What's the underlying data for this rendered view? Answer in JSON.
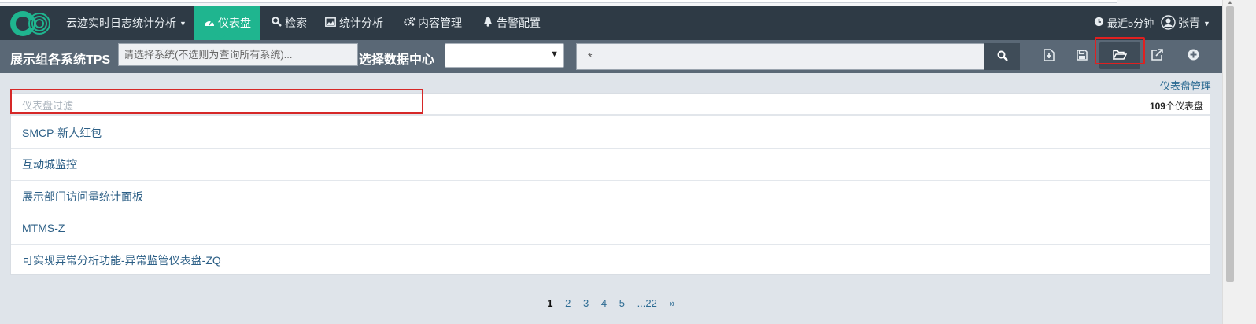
{
  "navbar": {
    "app_menu": "云迹实时日志统计分析",
    "items": [
      {
        "label": "仪表盘",
        "icon": "dashboard-icon",
        "active": true
      },
      {
        "label": "检索",
        "icon": "search-icon"
      },
      {
        "label": "统计分析",
        "icon": "image-chart-icon"
      },
      {
        "label": "内容管理",
        "icon": "gears-icon"
      },
      {
        "label": "告警配置",
        "icon": "bell-icon"
      }
    ],
    "time_range": "最近5分钟",
    "user": "张青"
  },
  "toolbar": {
    "title": "展示组各系统TPS",
    "system_placeholder": "请选择系统(不选则为查询所有系统)...",
    "datacenter_label": "选择数据中心",
    "datacenter_value": "",
    "query_value": "*",
    "icons": [
      "new-dashboard-icon",
      "save-icon",
      "open-folder-icon",
      "share-icon",
      "add-panel-icon"
    ]
  },
  "content": {
    "manage_link": "仪表盘管理",
    "filter_placeholder": "仪表盘过滤",
    "count_number": "109",
    "count_suffix": "个仪表盘",
    "dashboards": [
      "SMCP-新人红包",
      "互动城监控",
      "展示部门访问量统计面板",
      "MTMS-Z",
      "可实现异常分析功能-异常监管仪表盘-ZQ"
    ]
  },
  "pagination": {
    "pages": [
      "1",
      "2",
      "3",
      "4",
      "5",
      "...22",
      "»"
    ],
    "current": "1"
  },
  "colors": {
    "navbar_bg": "#2e3a45",
    "active_tab": "#1fb58f",
    "toolbar_bg": "#5a6876",
    "highlight_box": "#e02020"
  }
}
